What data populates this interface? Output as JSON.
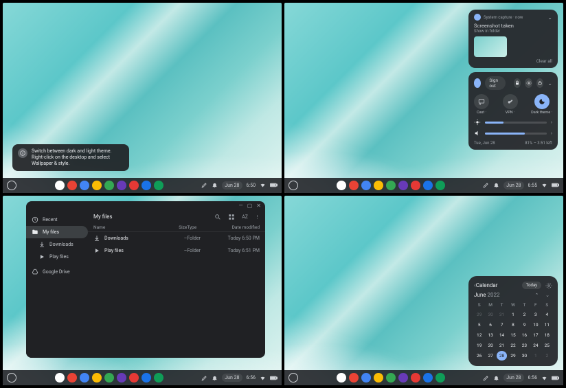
{
  "quad1": {
    "toast": {
      "title": "Switch between dark and light theme. Right-click on the desktop and select Wallpaper & style."
    },
    "shelf": {
      "date": "Jun 28",
      "time": "6:50"
    }
  },
  "quad2": {
    "notif": {
      "app": "System capture · now",
      "title": "Screenshot taken",
      "sub": "Show in folder",
      "clear": "Clear all"
    },
    "settings": {
      "signout": "Sign out",
      "tiles": [
        {
          "label": "Cast ·",
          "icon": "cast"
        },
        {
          "label": "VPN ·",
          "icon": "vpn"
        },
        {
          "label": "Dark theme ·",
          "icon": "dark",
          "active": true
        }
      ],
      "brightness": 30,
      "volume": 65,
      "footer_left": "Tue, Jun 28",
      "footer_right": "81% – 3:51 left"
    },
    "shelf": {
      "date": "Jun 28",
      "time": "6:55"
    }
  },
  "quad3": {
    "files": {
      "recent": "Recent",
      "myfiles": "My files",
      "downloads": "Downloads",
      "playfiles": "Play files",
      "gdrive": "Google Drive",
      "title": "My files",
      "az": "AZ",
      "cols": {
        "name": "Name",
        "size": "Size",
        "type": "Type",
        "date": "Date modified"
      },
      "rows": [
        {
          "name": "Downloads",
          "size": "–",
          "type": "Folder",
          "date": "Today 6:50 PM"
        },
        {
          "name": "Play files",
          "size": "–",
          "type": "Folder",
          "date": "Today 6:51 PM"
        }
      ]
    },
    "shelf": {
      "date": "Jun 28",
      "time": "6:56"
    }
  },
  "quad4": {
    "calendar": {
      "title": "Calendar",
      "today_btn": "Today",
      "month": "June",
      "year": "2022",
      "dow": [
        "S",
        "M",
        "T",
        "W",
        "T",
        "F",
        "S"
      ],
      "grid": [
        {
          "d": 29,
          "m": true
        },
        {
          "d": 30,
          "m": true
        },
        {
          "d": 31,
          "m": true
        },
        {
          "d": 1
        },
        {
          "d": 2
        },
        {
          "d": 3
        },
        {
          "d": 4
        },
        {
          "d": 5
        },
        {
          "d": 6
        },
        {
          "d": 7
        },
        {
          "d": 8
        },
        {
          "d": 9
        },
        {
          "d": 10
        },
        {
          "d": 11
        },
        {
          "d": 12
        },
        {
          "d": 13
        },
        {
          "d": 14
        },
        {
          "d": 15
        },
        {
          "d": 16
        },
        {
          "d": 17
        },
        {
          "d": 18
        },
        {
          "d": 19
        },
        {
          "d": 20
        },
        {
          "d": 21
        },
        {
          "d": 22
        },
        {
          "d": 23
        },
        {
          "d": 24
        },
        {
          "d": 25
        },
        {
          "d": 26
        },
        {
          "d": 27
        },
        {
          "d": 28,
          "sel": true
        },
        {
          "d": 29
        },
        {
          "d": 30
        },
        {
          "d": 1,
          "m": true
        },
        {
          "d": 2,
          "m": true
        }
      ]
    },
    "shelf": {
      "date": "Jun 28",
      "time": "6:56"
    }
  },
  "shelf_apps": [
    {
      "c": "#fff",
      "n": "chrome"
    },
    {
      "c": "#ea4335",
      "n": "gmail"
    },
    {
      "c": "#4285f4",
      "n": "docs"
    },
    {
      "c": "#fbbc04",
      "n": "keep"
    },
    {
      "c": "#34a853",
      "n": "sheets"
    },
    {
      "c": "#673ab7",
      "n": "app1"
    },
    {
      "c": "#e53935",
      "n": "youtube"
    },
    {
      "c": "#1a73e8",
      "n": "drive"
    },
    {
      "c": "#0f9d58",
      "n": "play"
    }
  ]
}
